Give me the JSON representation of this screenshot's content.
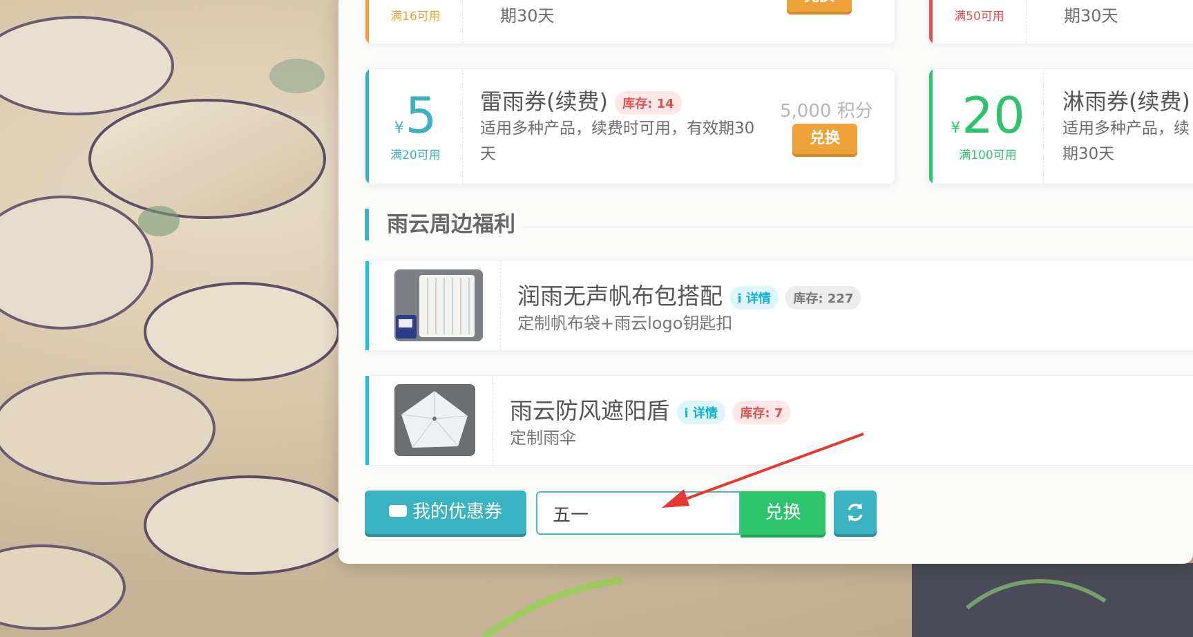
{
  "coupons_top": [
    {
      "cond": "满16可用",
      "desc_tail": "期30天",
      "btn": "兑换",
      "color": "#f0a23a"
    },
    {
      "cond": "满50可用",
      "desc_tail": "期30天",
      "color": "#e05252"
    }
  ],
  "coupons": [
    {
      "currency": "¥",
      "amount": "5",
      "cond": "满20可用",
      "title": "雷雨券(续费)",
      "stock": "库存: 14",
      "desc_line1": "适用多种产品，续费时可用，有效期30",
      "desc_line2": "天",
      "points": "5,000 积分",
      "btn": "兑换",
      "color": "#3bb2bf"
    },
    {
      "currency": "¥",
      "amount": "20",
      "cond": "满100可用",
      "title": "淋雨券(续费)",
      "desc_line1": "适用多种产品，续",
      "desc_line2": "期30天",
      "color": "#2dc46b"
    }
  ],
  "section": {
    "title": "雨云周边福利"
  },
  "goods": [
    {
      "title": "润雨无声帆布包搭配",
      "info": "i 详情",
      "stock": "库存: 227",
      "desc": "定制帆布袋+雨云logo钥匙扣"
    },
    {
      "title": "雨云防风遮阳盾",
      "info": "i 详情",
      "stock": "库存: 7",
      "desc": "定制雨伞"
    }
  ],
  "toolbar": {
    "my_coupons_label": "我的优惠券",
    "code_value": "五一",
    "redeem_label": "兑换"
  }
}
